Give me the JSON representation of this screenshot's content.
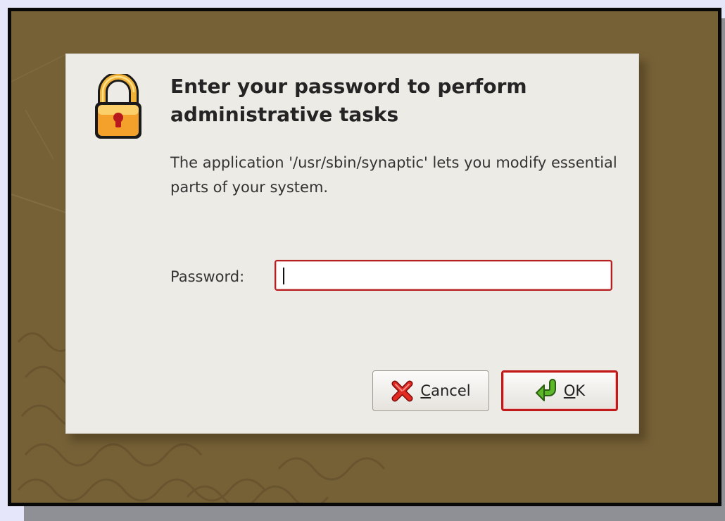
{
  "dialog": {
    "title": "Enter your password to perform administrative tasks",
    "description": "The application '/usr/sbin/synaptic' lets you modify essential parts of your system.",
    "password_label": "Password:",
    "password_value": "",
    "cancel_label": "Cancel",
    "cancel_mnemonic": "C",
    "cancel_rest": "ancel",
    "ok_label": "OK",
    "ok_mnemonic": "O",
    "ok_rest": "K"
  },
  "icons": {
    "dialog_icon": "padlock-icon",
    "cancel_icon": "red-x-icon",
    "ok_icon": "green-return-arrow-icon"
  },
  "colors": {
    "desktop_background": "#766137",
    "dialog_background": "#edebe6",
    "focus_border": "#c01a1a"
  }
}
